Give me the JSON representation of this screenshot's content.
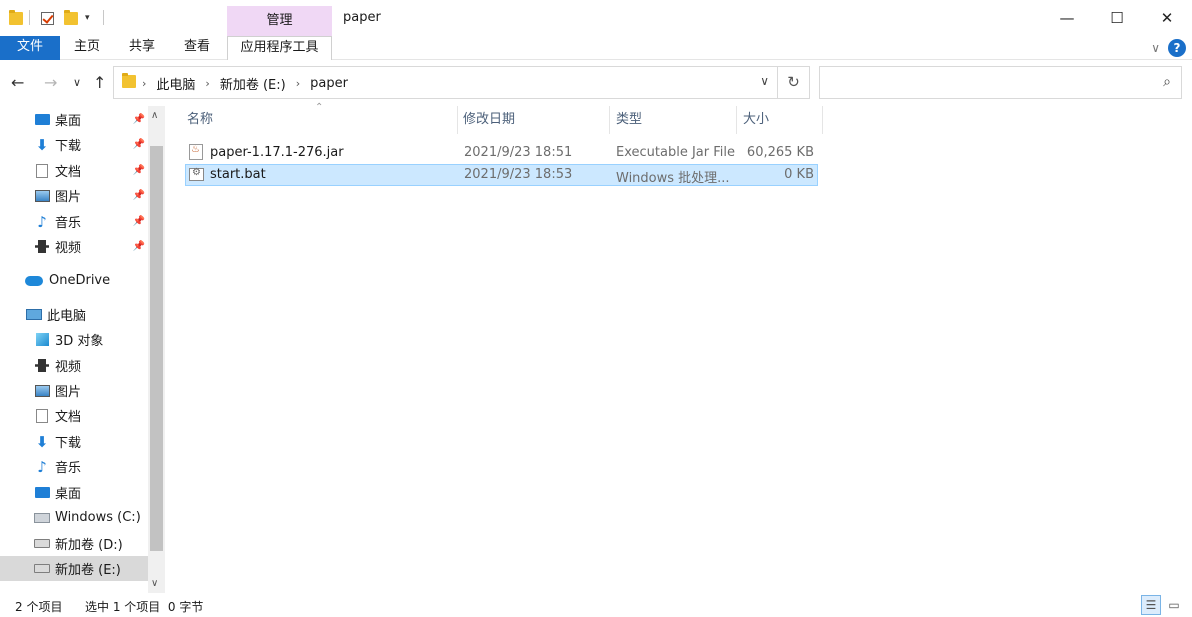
{
  "title_bar": {
    "manage_tab": "管理",
    "window_title": "paper",
    "minimize": "—",
    "maximize": "☐",
    "close": "✕"
  },
  "ribbon": {
    "tabs": [
      "文件",
      "主页",
      "共享",
      "查看",
      "应用程序工具"
    ],
    "expand": "∨",
    "help": "?"
  },
  "nav": {
    "back": "←",
    "forward": "→",
    "recent": "∨",
    "up": "↑",
    "breadcrumbs": [
      "此电脑",
      "新加卷 (E:)",
      "paper"
    ],
    "refresh": "↻",
    "search_placeholder": ""
  },
  "sidebar": {
    "quick_access": [
      {
        "label": "桌面",
        "icon": "desktop-icon"
      },
      {
        "label": "下载",
        "icon": "download-icon"
      },
      {
        "label": "文档",
        "icon": "document-icon"
      },
      {
        "label": "图片",
        "icon": "pictures-icon"
      },
      {
        "label": "音乐",
        "icon": "music-icon"
      },
      {
        "label": "视频",
        "icon": "video-icon"
      }
    ],
    "onedrive": "OneDrive",
    "this_pc": "此电脑",
    "pc_items": [
      {
        "label": "3D 对象",
        "icon": "3d-objects-icon"
      },
      {
        "label": "视频",
        "icon": "video-icon"
      },
      {
        "label": "图片",
        "icon": "pictures-icon"
      },
      {
        "label": "文档",
        "icon": "document-icon"
      },
      {
        "label": "下载",
        "icon": "download-icon"
      },
      {
        "label": "音乐",
        "icon": "music-icon"
      },
      {
        "label": "桌面",
        "icon": "desktop-icon"
      },
      {
        "label": "Windows (C:)",
        "icon": "drive-c-icon"
      },
      {
        "label": "新加卷 (D:)",
        "icon": "drive-icon"
      },
      {
        "label": "新加卷 (E:)",
        "icon": "drive-icon"
      }
    ]
  },
  "file_list": {
    "columns": [
      "名称",
      "修改日期",
      "类型",
      "大小"
    ],
    "rows": [
      {
        "name": "paper-1.17.1-276.jar",
        "modified": "2021/9/23 18:51",
        "type": "Executable Jar File",
        "size": "60,265 KB"
      },
      {
        "name": "start.bat",
        "modified": "2021/9/23 18:53",
        "type": "Windows 批处理...",
        "size": "0 KB"
      }
    ]
  },
  "status": {
    "item_count": "2 个项目",
    "selection": "选中 1 个项目  0 字节"
  }
}
